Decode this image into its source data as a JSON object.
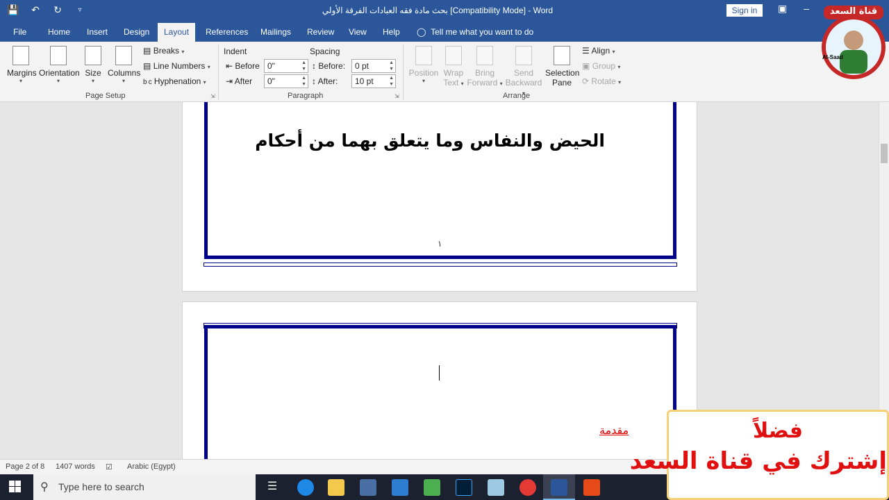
{
  "window": {
    "title": "بحث مادة فقه العبادات الفرقة الأولي [Compatibility Mode]  -  Word",
    "sign_in": "Sign in"
  },
  "tabs": [
    "File",
    "Home",
    "Insert",
    "Design",
    "Layout",
    "References",
    "Mailings",
    "Review",
    "View",
    "Help"
  ],
  "active_tab": "Layout",
  "tell_me": "Tell me what you want to do",
  "ribbon": {
    "page_setup": {
      "margins": "Margins",
      "orientation": "Orientation",
      "size": "Size",
      "columns": "Columns",
      "breaks": "Breaks",
      "line_numbers": "Line Numbers",
      "hyphenation": "Hyphenation",
      "label": "Page Setup"
    },
    "paragraph": {
      "indent": "Indent",
      "spacing": "Spacing",
      "before_label": "Before",
      "after_label": "After",
      "indent_before": "0\"",
      "indent_after": "0\"",
      "spacing_before_label": "Before:",
      "spacing_after_label": "After:",
      "spacing_before": "0 pt",
      "spacing_after": "10 pt",
      "label": "Paragraph"
    },
    "arrange": {
      "position": "Position",
      "wrap_text_1": "Wrap",
      "wrap_text_2": "Text",
      "bring_forward_1": "Bring",
      "bring_forward_2": "Forward",
      "send_backward_1": "Send",
      "send_backward_2": "Backward",
      "selection_pane_1": "Selection",
      "selection_pane_2": "Pane",
      "align": "Align",
      "group": "Group",
      "rotate": "Rotate",
      "label": "Arrange"
    }
  },
  "document": {
    "page1_heading": "الحيض والنفاس وما يتعلق بهما من أحكام",
    "page1_number": "١",
    "page2_subheading": "مقدمة"
  },
  "statusbar": {
    "page": "Page 2 of 8",
    "words": "1407 words",
    "language": "Arabic (Egypt)"
  },
  "taskbar": {
    "search_placeholder": "Type here to search"
  },
  "overlay": {
    "line1": "فضلاً",
    "line2": "إشترك في قناة السعد"
  },
  "logo": {
    "text": "قناة السعد",
    "sub": "Al-Saad"
  },
  "colors": {
    "word_blue": "#2b579a",
    "frame_blue": "#00008b",
    "red": "#e01010"
  }
}
